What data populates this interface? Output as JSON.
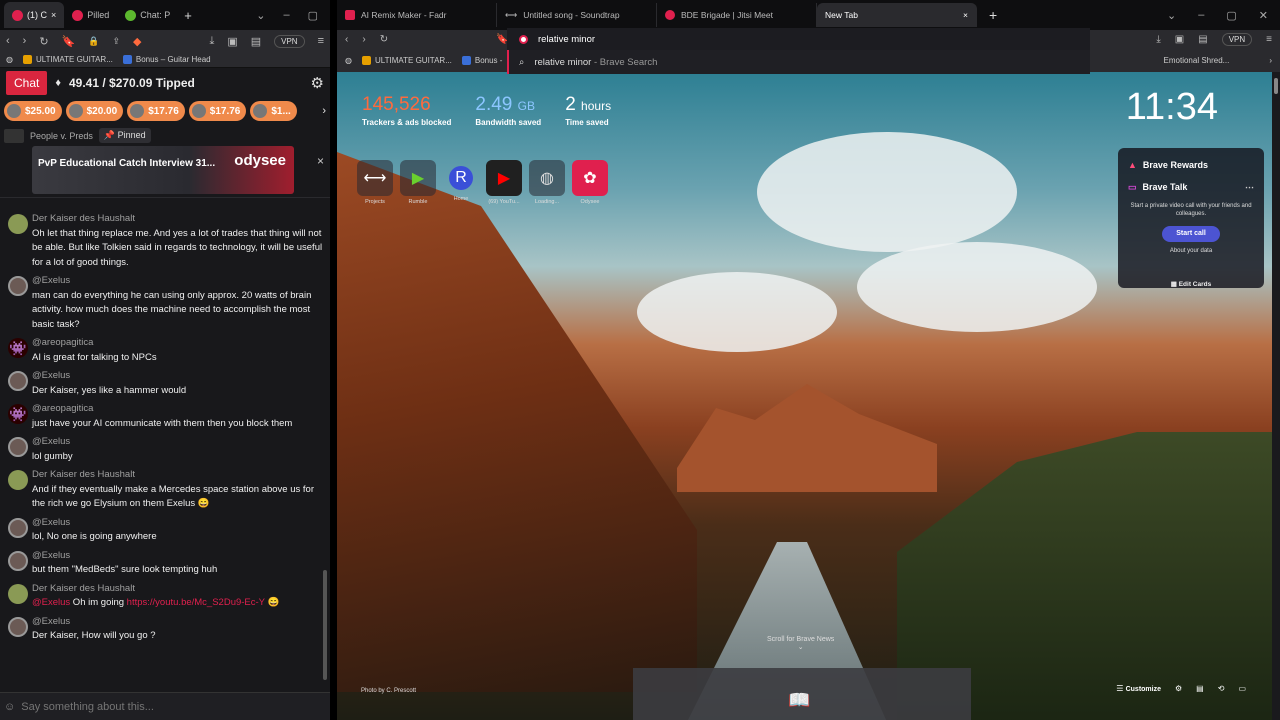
{
  "left": {
    "tabs": [
      {
        "label": "(1) C"
      },
      {
        "label": "Pilled"
      },
      {
        "label": "Chat: P"
      }
    ],
    "toolbar": {
      "vpn": "VPN"
    },
    "bookmarks": [
      {
        "label": "ULTIMATE GUITAR..."
      },
      {
        "label": "Bonus – Guitar Head"
      }
    ],
    "chat": {
      "tab_label": "Chat",
      "tipped": "49.41 / $270.09 Tipped",
      "tips": [
        "$25.00",
        "$20.00",
        "$17.76",
        "$17.76",
        "$1..."
      ],
      "pinned": {
        "channel": "People v. Preds",
        "badge": "Pinned",
        "title": "PvP Educational Catch Interview 31...",
        "logo": "odysee"
      },
      "messages": [
        {
          "name": "Der Kaiser des Haushalt",
          "text": "Oh let that thing replace me. And yes a lot of trades that thing will not be able. But like Tolkien said in regards to technology, it will be useful for a lot of good things.",
          "avatar": "green"
        },
        {
          "name": "@Exelus",
          "text": "man can do everything he can using only approx. 20 watts of brain activity. how much does the machine need to accomplish the most basic task?",
          "avatar": "grey"
        },
        {
          "name": "@areopagitica",
          "text": "AI is great for talking to NPCs",
          "avatar": "red"
        },
        {
          "name": "@Exelus",
          "text": "Der Kaiser, yes like a hammer would",
          "avatar": "grey"
        },
        {
          "name": "@areopagitica",
          "text": "just have your AI communicate with them then you block them",
          "avatar": "red"
        },
        {
          "name": "@Exelus",
          "text": "lol gumby",
          "avatar": "grey"
        },
        {
          "name": "Der Kaiser des Haushalt",
          "text": "And if they eventually make a Mercedes space station above us for the rich we go Elysium on them Exelus 😄",
          "avatar": "green"
        },
        {
          "name": "@Exelus",
          "text": "lol, No one is going anywhere",
          "avatar": "grey"
        },
        {
          "name": "@Exelus",
          "text": "but them \"MedBeds\" sure look tempting huh",
          "avatar": "grey"
        },
        {
          "name": "Der Kaiser des Haushalt",
          "text_mention": "@Exelus",
          "text": " Oh im going ",
          "text_link": "https://youtu.be/Mc_S2Du9-Ec-Y",
          "text_end": " 😄",
          "avatar": "green"
        },
        {
          "name": "@Exelus",
          "text": "Der Kaiser, How will you go ?",
          "avatar": "grey"
        }
      ],
      "input_placeholder": "Say something about this..."
    }
  },
  "right": {
    "tabs": [
      {
        "label": "AI Remix Maker - Fadr",
        "color": "#e0204e"
      },
      {
        "label": "Untitled song - Soundtrap",
        "color": "#888888"
      },
      {
        "label": "BDE Brigade | Jitsi Meet",
        "color": "#e0204e"
      },
      {
        "label": "New Tab",
        "color": "#2a2a2e"
      }
    ],
    "omnibox": {
      "value": "relative minor",
      "suggestion": "relative minor",
      "suggestion_sub": " - Brave Search"
    },
    "toolbar": {
      "vpn": "VPN"
    },
    "bookmarks": [
      {
        "label": "ULTIMATE GUITAR..."
      },
      {
        "label": "Bonus -"
      }
    ],
    "bookmark_right": "Emotional Shred...",
    "ntp": {
      "stats": [
        {
          "value": "145,526",
          "unit": "",
          "label": "Trackers & ads blocked",
          "color": "orange"
        },
        {
          "value": "2.49",
          "unit": "GB",
          "label": "Bandwidth saved",
          "color": "blue"
        },
        {
          "value": "2",
          "unit": "hours",
          "label": "Time saved",
          "color": "white"
        }
      ],
      "clock": "11:34",
      "tiles": [
        {
          "label": "Projects",
          "glyph": "⟷"
        },
        {
          "label": "Rumble",
          "glyph": "▶"
        },
        {
          "label": "Home",
          "glyph": "R"
        },
        {
          "label": "(69) YouTu...",
          "glyph": "▶"
        },
        {
          "label": "Loading...",
          "glyph": "◍"
        },
        {
          "label": "Odysee",
          "glyph": "✿"
        }
      ],
      "widget": {
        "rewards": "Brave Rewards",
        "talk": "Brave Talk",
        "desc": "Start a private video call with your friends and colleagues.",
        "button": "Start call",
        "data": "About your data",
        "edit": "Edit Cards"
      },
      "scroll_news": "Scroll for Brave News",
      "photo_by": "Photo by C. Prescott",
      "customize": "Customize"
    }
  }
}
